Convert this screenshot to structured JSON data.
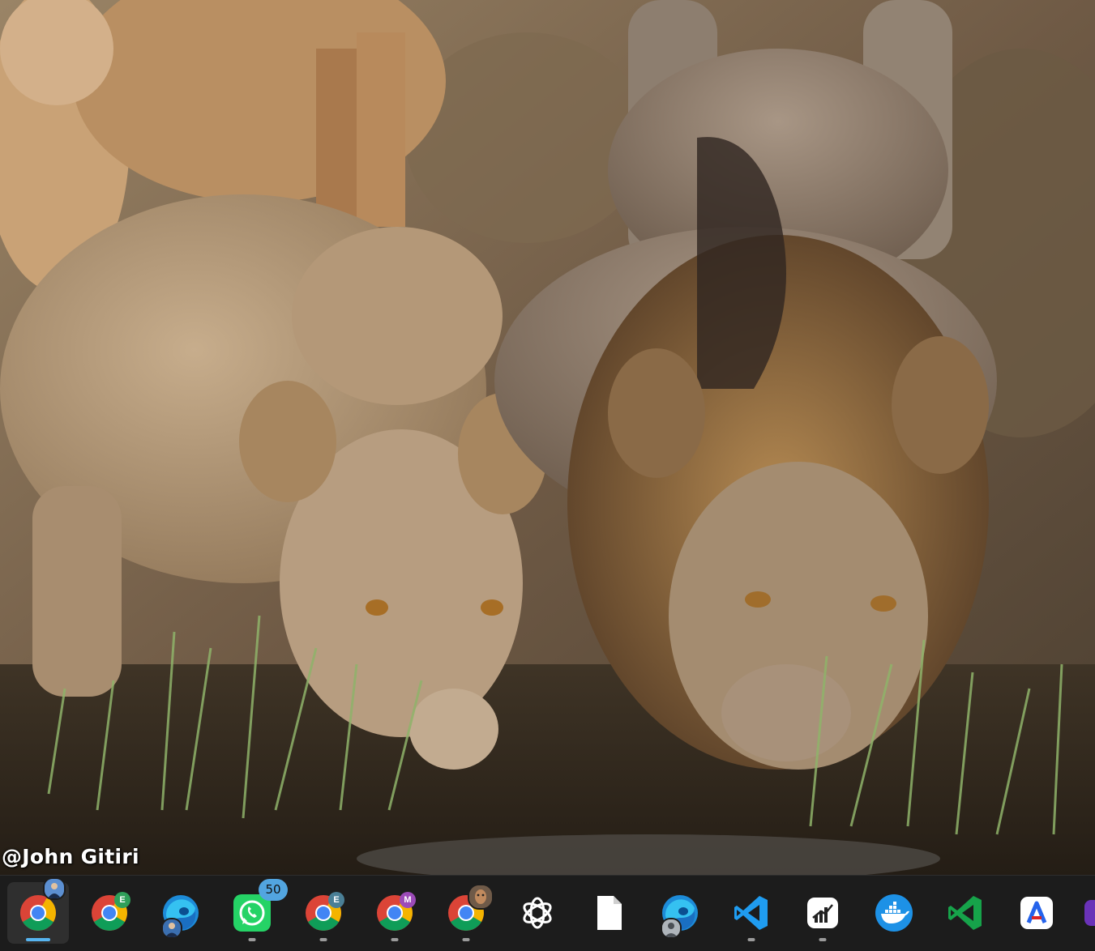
{
  "wallpaper": {
    "credit": "@John Gitiri"
  },
  "taskbar": {
    "apps": [
      {
        "name": "chrome",
        "icon": "chrome-icon",
        "badge": "",
        "badge_type": "avatar",
        "active": true,
        "running": true
      },
      {
        "name": "chrome-profile-e",
        "icon": "chrome-icon",
        "badge": "E",
        "badge_type": "profile",
        "badge_color": "#2f9f5a",
        "active": false,
        "running": false
      },
      {
        "name": "edge-profile",
        "icon": "edge-icon",
        "badge": "",
        "badge_type": "avatar",
        "active": false,
        "running": false
      },
      {
        "name": "whatsapp",
        "icon": "whatsapp-icon",
        "badge": "50",
        "badge_type": "count",
        "active": false,
        "running": true
      },
      {
        "name": "chrome-profile-e2",
        "icon": "chrome-icon",
        "badge": "E",
        "badge_type": "profile",
        "badge_color": "#4a7f96",
        "active": false,
        "running": true
      },
      {
        "name": "chrome-profile-m",
        "icon": "chrome-icon",
        "badge": "M",
        "badge_type": "profile",
        "badge_color": "#9c4bb8",
        "active": false,
        "running": true
      },
      {
        "name": "chrome-profile-photo",
        "icon": "chrome-icon",
        "badge": "",
        "badge_type": "photo",
        "active": false,
        "running": true
      },
      {
        "name": "chatgpt",
        "icon": "chatgpt-icon",
        "badge": "",
        "badge_type": "none",
        "active": false,
        "running": false
      },
      {
        "name": "file",
        "icon": "file-icon",
        "badge": "",
        "badge_type": "none",
        "active": false,
        "running": false
      },
      {
        "name": "edge",
        "icon": "edge-icon",
        "badge": "",
        "badge_type": "person",
        "active": false,
        "running": false
      },
      {
        "name": "vscode",
        "icon": "vscode-icon",
        "badge": "",
        "badge_type": "none",
        "active": false,
        "running": true
      },
      {
        "name": "trading-app",
        "icon": "chart-app-icon",
        "badge": "",
        "badge_type": "none",
        "active": false,
        "running": true
      },
      {
        "name": "docker",
        "icon": "docker-icon",
        "badge": "",
        "badge_type": "none",
        "active": false,
        "running": false
      },
      {
        "name": "visual-studio",
        "icon": "visual-studio-icon",
        "badge": "",
        "badge_type": "none",
        "active": false,
        "running": false
      },
      {
        "name": "arc-app",
        "icon": "a-app-icon",
        "badge": "",
        "badge_type": "none",
        "active": false,
        "running": false
      }
    ]
  }
}
